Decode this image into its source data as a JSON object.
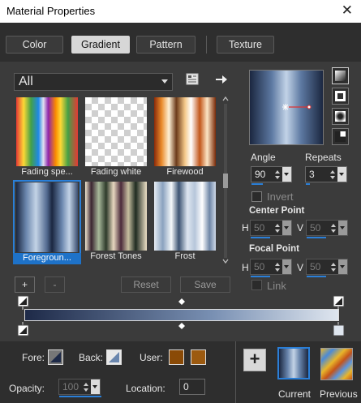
{
  "window": {
    "title": "Material Properties",
    "close_glyph": "✕"
  },
  "tabs": [
    {
      "label": "Color",
      "active": false
    },
    {
      "label": "Gradient",
      "active": true
    },
    {
      "label": "Pattern",
      "active": false
    },
    {
      "label": "Texture",
      "active": false
    }
  ],
  "library": {
    "category": "All",
    "icons": [
      "library-book-icon",
      "arrow-right-icon"
    ],
    "items": [
      {
        "label": "Fading spe...",
        "selected": false
      },
      {
        "label": "Fading white",
        "selected": false
      },
      {
        "label": "Firewood",
        "selected": false
      },
      {
        "label": "Foregroun...",
        "selected": true
      },
      {
        "label": "Forest Tones",
        "selected": false
      },
      {
        "label": "Frost",
        "selected": false
      }
    ]
  },
  "style_icons": [
    "linear-style-icon",
    "rectangular-style-icon",
    "sunburst-style-icon",
    "radial-style-icon"
  ],
  "angle": {
    "label": "Angle",
    "value": "90"
  },
  "repeats": {
    "label": "Repeats",
    "value": "3"
  },
  "invert": {
    "label": "Invert",
    "checked": false
  },
  "center_point": {
    "label": "Center Point",
    "h_label": "H",
    "h_value": "50",
    "v_label": "V",
    "v_value": "50"
  },
  "focal_point": {
    "label": "Focal Point",
    "h_label": "H",
    "h_value": "50",
    "v_label": "V",
    "v_value": "50"
  },
  "link": {
    "label": "Link",
    "checked": false
  },
  "buttons": {
    "add": "+",
    "remove": "-",
    "reset": "Reset",
    "save": "Save"
  },
  "bottom": {
    "fore_label": "Fore:",
    "back_label": "Back:",
    "user_label": "User:",
    "opacity_label": "Opacity:",
    "opacity_value": "100",
    "location_label": "Location:",
    "location_value": "0",
    "add_glyph": "+",
    "current_label": "Current",
    "previous_label": "Previous"
  },
  "colors": {
    "accent": "#2a7fd8",
    "user_swatch_1": "#8a4a06",
    "user_swatch_2": "#9c5a10",
    "gradient_dark": "#1e2a48",
    "gradient_light": "#dfe6ef"
  }
}
